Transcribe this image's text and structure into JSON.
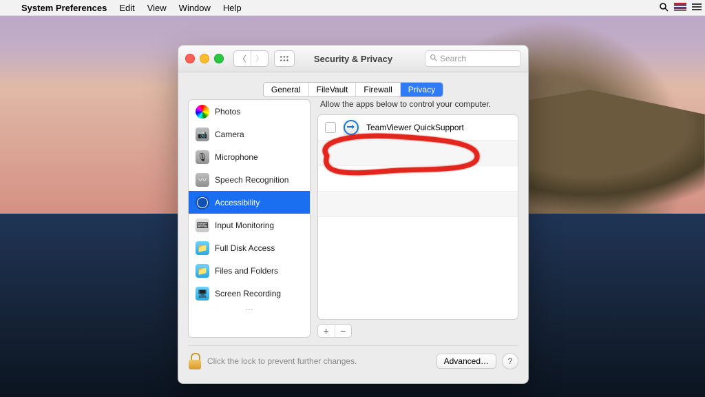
{
  "menubar": {
    "app": "System Preferences",
    "items": [
      "Edit",
      "View",
      "Window",
      "Help"
    ]
  },
  "window": {
    "title": "Security & Privacy",
    "search_placeholder": "Search",
    "tabs": [
      "General",
      "FileVault",
      "Firewall",
      "Privacy"
    ],
    "active_tab": "Privacy"
  },
  "sidebar": {
    "items": [
      {
        "label": "Photos"
      },
      {
        "label": "Camera"
      },
      {
        "label": "Microphone"
      },
      {
        "label": "Speech Recognition"
      },
      {
        "label": "Accessibility"
      },
      {
        "label": "Input Monitoring"
      },
      {
        "label": "Full Disk Access"
      },
      {
        "label": "Files and Folders"
      },
      {
        "label": "Screen Recording"
      }
    ],
    "selected_index": 4
  },
  "right": {
    "heading": "Allow the apps below to control your computer.",
    "apps": [
      {
        "name": "TeamViewer QuickSupport",
        "checked": false
      }
    ],
    "add": "+",
    "remove": "−"
  },
  "footer": {
    "lock_text": "Click the lock to prevent further changes.",
    "advanced": "Advanced…",
    "help": "?"
  }
}
